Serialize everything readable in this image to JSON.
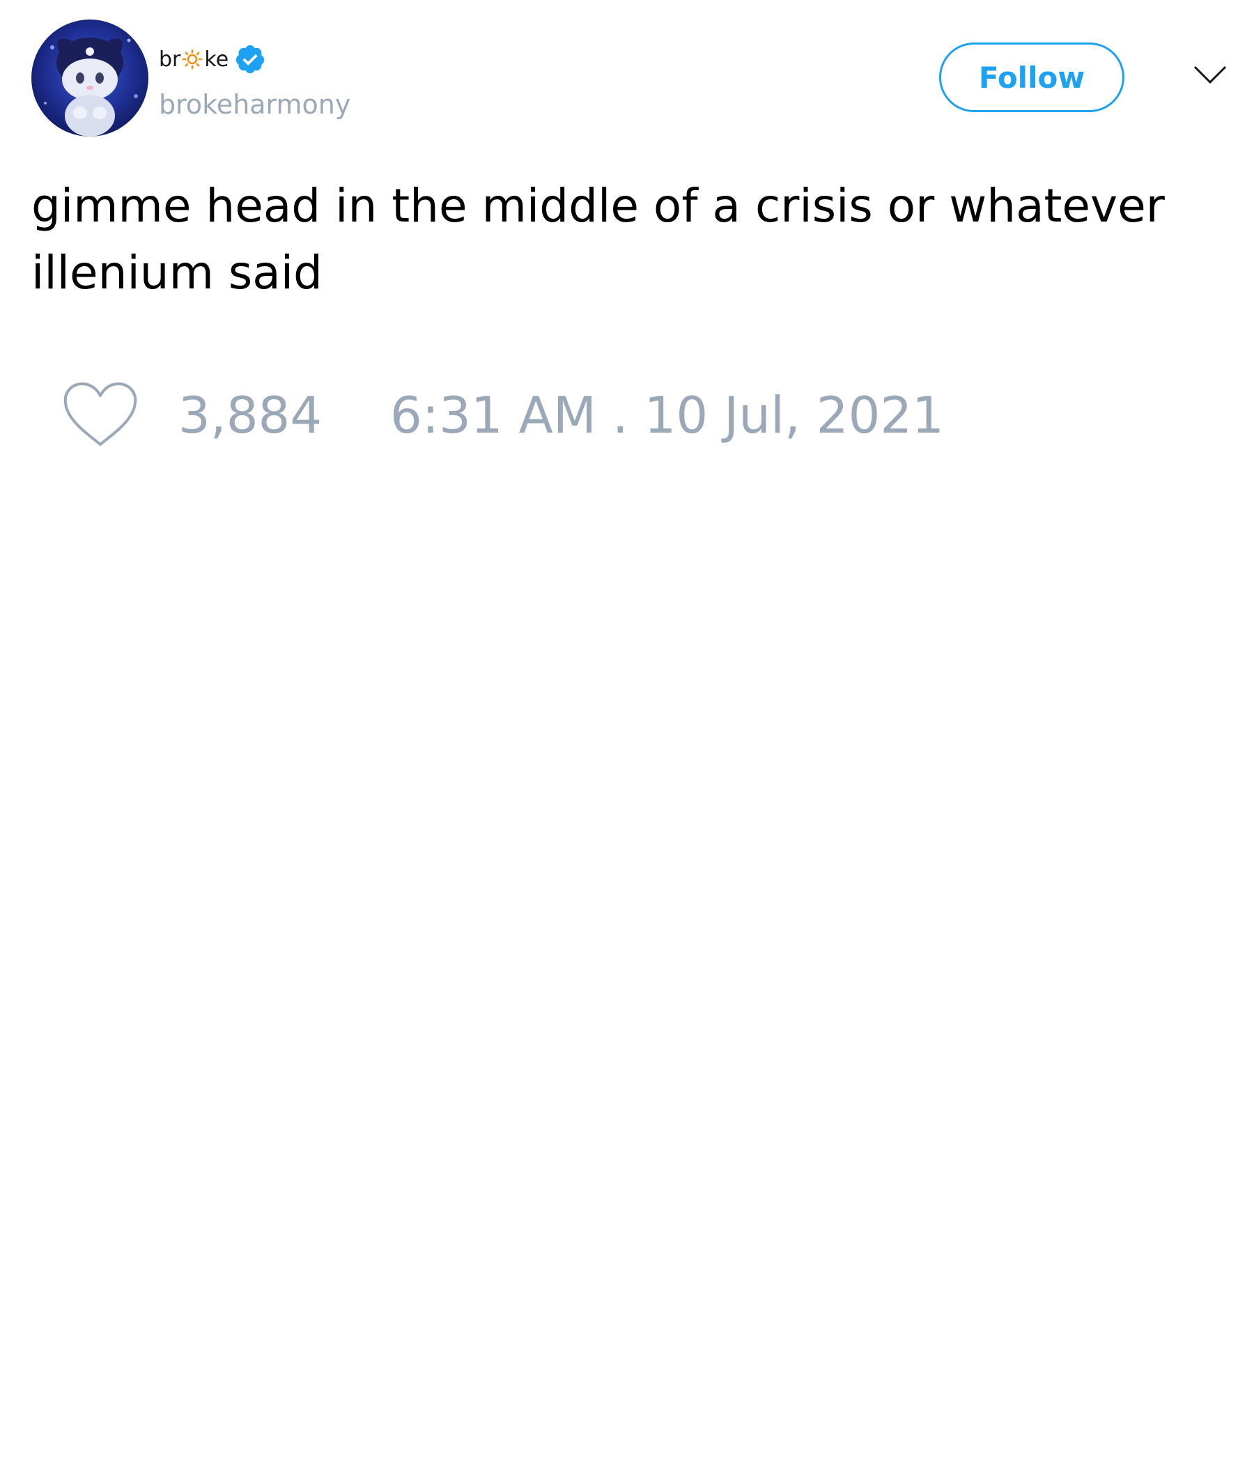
{
  "tweet": {
    "author": {
      "display_name_start": "br",
      "display_name_emoji": "sun-emoji",
      "display_name_end": "ke",
      "verified": true,
      "handle": "brokeharmony"
    },
    "follow_label": "Follow",
    "menu_icon": "chevron-down-icon",
    "text_lines": [
      "gimme head in the middle of a crisis or whatever",
      "illenium said"
    ],
    "like_icon": "heart-icon",
    "likes": "3,884",
    "timestamp": "6:31 AM . 10 Jul, 2021"
  },
  "colors": {
    "accent": "#1da1f2",
    "muted": "#9aa8b7",
    "text": "#000000",
    "sun": "#f4900c"
  }
}
